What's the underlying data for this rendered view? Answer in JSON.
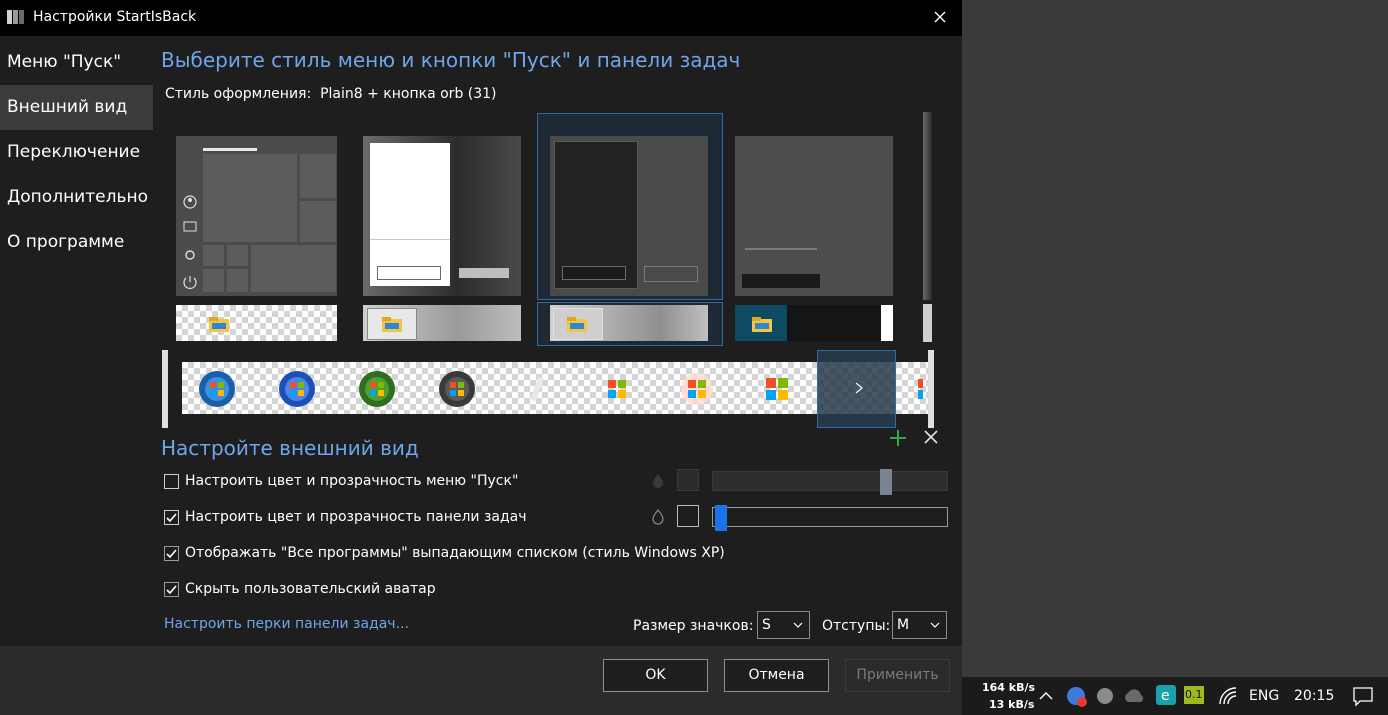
{
  "window": {
    "title": "Настройки StartIsBack"
  },
  "sidebar": {
    "items": [
      {
        "label": "Меню \"Пуск\"",
        "selected": false
      },
      {
        "label": "Внешний вид",
        "selected": true
      },
      {
        "label": "Переключение",
        "selected": false
      },
      {
        "label": "Дополнительно",
        "selected": false
      },
      {
        "label": "О программе",
        "selected": false
      }
    ]
  },
  "main": {
    "heading": "Выберите стиль меню и кнопки \"Пуск\" и панели задач",
    "style_label": "Стиль оформления:",
    "style_value": "Plain8 + кнопка orb (31)",
    "gallery": {
      "menu_styles_count": 4,
      "selected_menu_style": 3,
      "orb_styles_count": 8
    },
    "customize_heading": "Настройте внешний вид",
    "options": [
      {
        "label": "Настроить цвет и прозрачность меню \"Пуск\"",
        "checked": false
      },
      {
        "label": "Настроить цвет и прозрачность панели задач",
        "checked": true
      },
      {
        "label": "Отображать \"Все программы\" выпадающим списком (стиль Windows XP)",
        "checked": true
      },
      {
        "label": "Скрыть пользовательский аватар",
        "checked": true
      }
    ],
    "menu_transparency_level": 0.75,
    "taskbar_transparency_level": 0.0,
    "taskbar_link": "Настроить перки панели задач...",
    "icon_size_label": "Размер значков:",
    "icon_size_value": "S",
    "padding_label": "Отступы:",
    "padding_value": "M"
  },
  "buttons": {
    "ok": "OK",
    "cancel": "Отмена",
    "apply": "Применить"
  },
  "taskbar": {
    "net_down": "164 kB/s",
    "net_up": "13 kB/s",
    "badge_value": "0.1",
    "language": "ENG",
    "time": "20:15"
  },
  "colors": {
    "accent": "#6fa5ea",
    "selection": "#2f6aa3",
    "slider_active": "#1a73e8",
    "background": "#1e1e1e"
  }
}
